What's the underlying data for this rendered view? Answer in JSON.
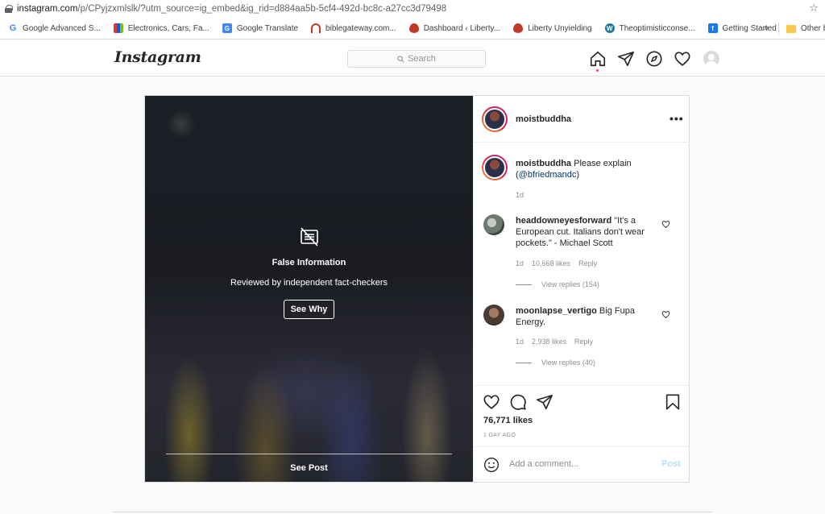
{
  "browser": {
    "url_host": "instagram.com",
    "url_rest": "/p/CPyjzxmlslk/?utm_source=ig_embed&ig_rid=d884aa5b-5cf4-492d-bc8c-a27cc3d79498",
    "bookmarks": [
      {
        "label": "Google Advanced S...",
        "icon": "google-icon",
        "color": "#4285f4"
      },
      {
        "label": "Electronics, Cars, Fa...",
        "icon": "ebay-icon",
        "color": "#86b817"
      },
      {
        "label": "Google Translate",
        "icon": "translate-icon",
        "color": "#4285f4"
      },
      {
        "label": "biblegateway.com...",
        "icon": "biblegateway-icon",
        "color": "#c0392b"
      },
      {
        "label": "Dashboard ‹ Liberty...",
        "icon": "liberty-flame-icon",
        "color": "#c0392b"
      },
      {
        "label": "Liberty Unyielding",
        "icon": "liberty-flame-icon",
        "color": "#c0392b"
      },
      {
        "label": "Theoptimisticconse...",
        "icon": "wordpress-icon",
        "color": "#21759b"
      },
      {
        "label": "Getting Started",
        "icon": "facebook-icon",
        "color": "#1877f2"
      }
    ],
    "more_label": "»",
    "other_label": "Other b"
  },
  "header": {
    "logo": "Instagram",
    "search_placeholder": "Search"
  },
  "post": {
    "warning": {
      "title": "False Information",
      "subtitle": "Reviewed by independent fact-checkers",
      "button": "See Why",
      "see_post": "See Post"
    },
    "username": "moistbuddha",
    "more": "•••",
    "caption": {
      "username": "moistbuddha",
      "text": " Please explain (",
      "mention": "@bfriedmandc",
      "close": ")",
      "time": "1d"
    },
    "comments": [
      {
        "username": "headdowneyesforward",
        "text": " \"It's a European cut. Italians don't wear pockets.\" - Michael Scott",
        "time": "1d",
        "likes": "10,668 likes",
        "reply": "Reply",
        "view_replies": "View replies (154)"
      },
      {
        "username": "moonlapse_vertigo",
        "text": " Big Fupa Energy.",
        "time": "1d",
        "likes": "2,938 likes",
        "reply": "Reply",
        "view_replies": "View replies (40)"
      }
    ],
    "likes": "76,771 likes",
    "ago": "1 DAY AGO",
    "comment_placeholder": "Add a comment...",
    "post_label": "Post"
  }
}
